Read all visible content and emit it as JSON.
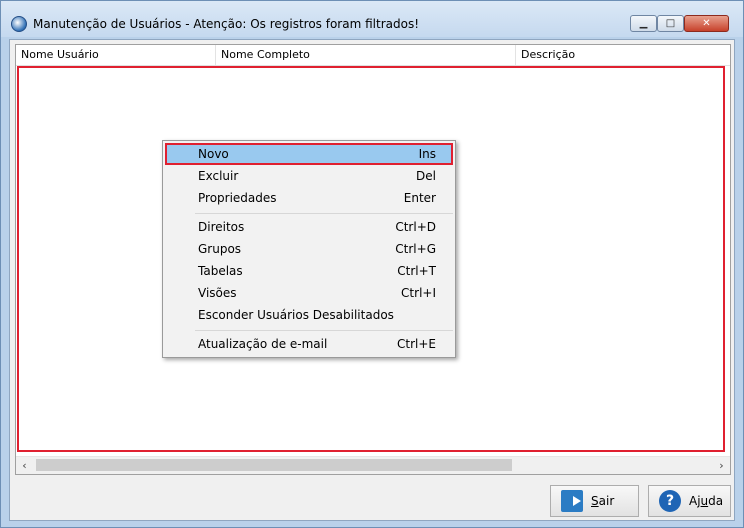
{
  "window": {
    "title": "Manutenção de Usuários - Atenção: Os registros foram filtrados!",
    "minimize": "▁",
    "maximize": "□",
    "close": "✕"
  },
  "grid": {
    "columns": [
      "Nome Usuário",
      "Nome Completo",
      "Descrição"
    ],
    "rows": []
  },
  "scrollbar": {
    "left": "‹",
    "right": "›"
  },
  "context_menu": {
    "items": [
      {
        "label": "Novo",
        "shortcut": "Ins",
        "highlighted": true
      },
      {
        "label": "Excluir",
        "shortcut": "Del"
      },
      {
        "label": "Propriedades",
        "shortcut": "Enter"
      },
      {
        "label": "Direitos",
        "shortcut": "Ctrl+D"
      },
      {
        "label": "Grupos",
        "shortcut": "Ctrl+G"
      },
      {
        "label": "Tabelas",
        "shortcut": "Ctrl+T"
      },
      {
        "label": "Visões",
        "shortcut": "Ctrl+I"
      },
      {
        "label": "Esconder Usuários Desabilitados",
        "shortcut": ""
      },
      {
        "label": "Atualização de e-mail",
        "shortcut": "Ctrl+E"
      }
    ]
  },
  "buttons": {
    "sair_prefix": "",
    "sair_underlined": "S",
    "sair_rest": "air",
    "ajuda_prefix": "Aj",
    "ajuda_underlined": "u",
    "ajuda_rest": "da",
    "help_glyph": "?"
  },
  "colors": {
    "highlight": "#99c9ef",
    "annotation_red": "#e02030",
    "title_bg": "#c5d9ef"
  }
}
